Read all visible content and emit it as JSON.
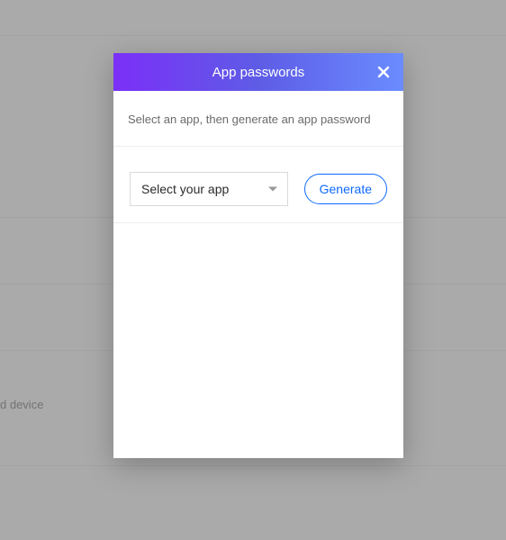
{
  "background": {
    "device_text": "d device"
  },
  "modal": {
    "title": "App passwords",
    "instruction": "Select an app, then generate an app password",
    "select": {
      "selected": "Select your app"
    },
    "generate_label": "Generate"
  }
}
